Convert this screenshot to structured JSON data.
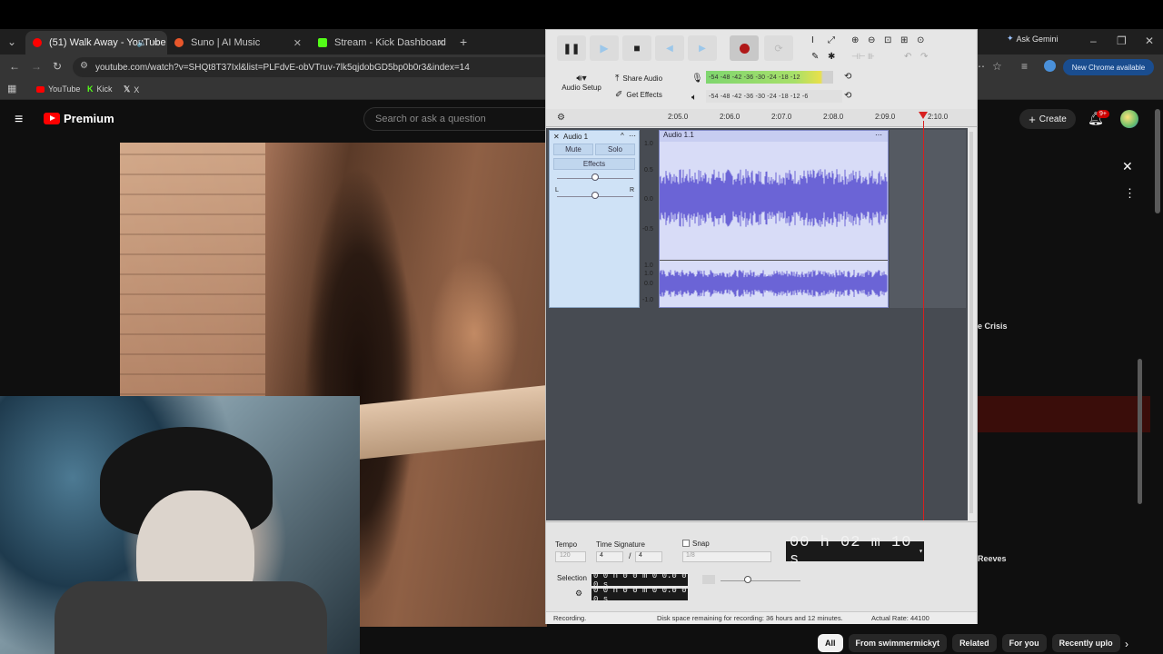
{
  "browser": {
    "tabs": [
      {
        "title": "(51) Walk Away - YouTube",
        "favicon_color": "#ff0000"
      },
      {
        "title": "Suno | AI Music",
        "favicon_color": "#e8572b"
      },
      {
        "title": "Stream - Kick Dashboard",
        "favicon_color": "#53fc18"
      }
    ],
    "url": "youtube.com/watch?v=SHQt8T37Ixl&list=PLFdvE-obVTruv-7lk5qjdobGD5bp0b0r3&index=14",
    "bookmarks": [
      "YouTube",
      "Kick",
      "X"
    ],
    "ask_gemini": "Ask Gemini",
    "update_badge": "New Chrome available"
  },
  "youtube": {
    "logo_text": "Premium",
    "search_placeholder": "Search or ask a question",
    "create_label": "Create",
    "notification_count": "9+",
    "panel_texts": [
      "e Crisis",
      "Reeves"
    ],
    "chips": [
      "All",
      "From swimmermickyt",
      "Related",
      "For you",
      "Recently uplo"
    ]
  },
  "audacity": {
    "audio_setup": "Audio Setup",
    "share_audio": "Share Audio",
    "get_effects": "Get Effects",
    "meter_record": "-54 -48 -42 -36 -30 -24 -18 -12",
    "meter_play": "-54 -48 -42 -36 -30 -24 -18 -12 -6",
    "ruler_ticks": [
      "2:05.0",
      "2:06.0",
      "2:07.0",
      "2:08.0",
      "2:09.0",
      "2:10.0"
    ],
    "track_name": "Audio 1",
    "mute": "Mute",
    "solo": "Solo",
    "effects": "Effects",
    "pan_left": "L",
    "pan_right": "R",
    "clip_name": "Audio 1.1",
    "y_scale_top": [
      "1.0",
      "0.5",
      "0.0",
      "-0.5"
    ],
    "y_scale_bottom": [
      "1.0",
      "1.0",
      "0.0",
      "-1.0"
    ],
    "tempo_label": "Tempo",
    "tempo_value": "120",
    "time_sig_label": "Time Signature",
    "time_sig_num": "4",
    "time_sig_den": "4",
    "snap_label": "Snap",
    "snap_value": "1/8",
    "timecode": "00 h 02 m 10 s",
    "selection_label": "Selection",
    "selection_start": "0 0 h 0 0 m 0 0.0 0 0 s",
    "selection_end": "0 0 h 0 0 m 0 0.0 0 0 s",
    "status_left": "Recording.",
    "status_mid": "Disk space remaining for recording: 36 hours and 12 minutes.",
    "status_right": "Actual Rate: 44100"
  }
}
